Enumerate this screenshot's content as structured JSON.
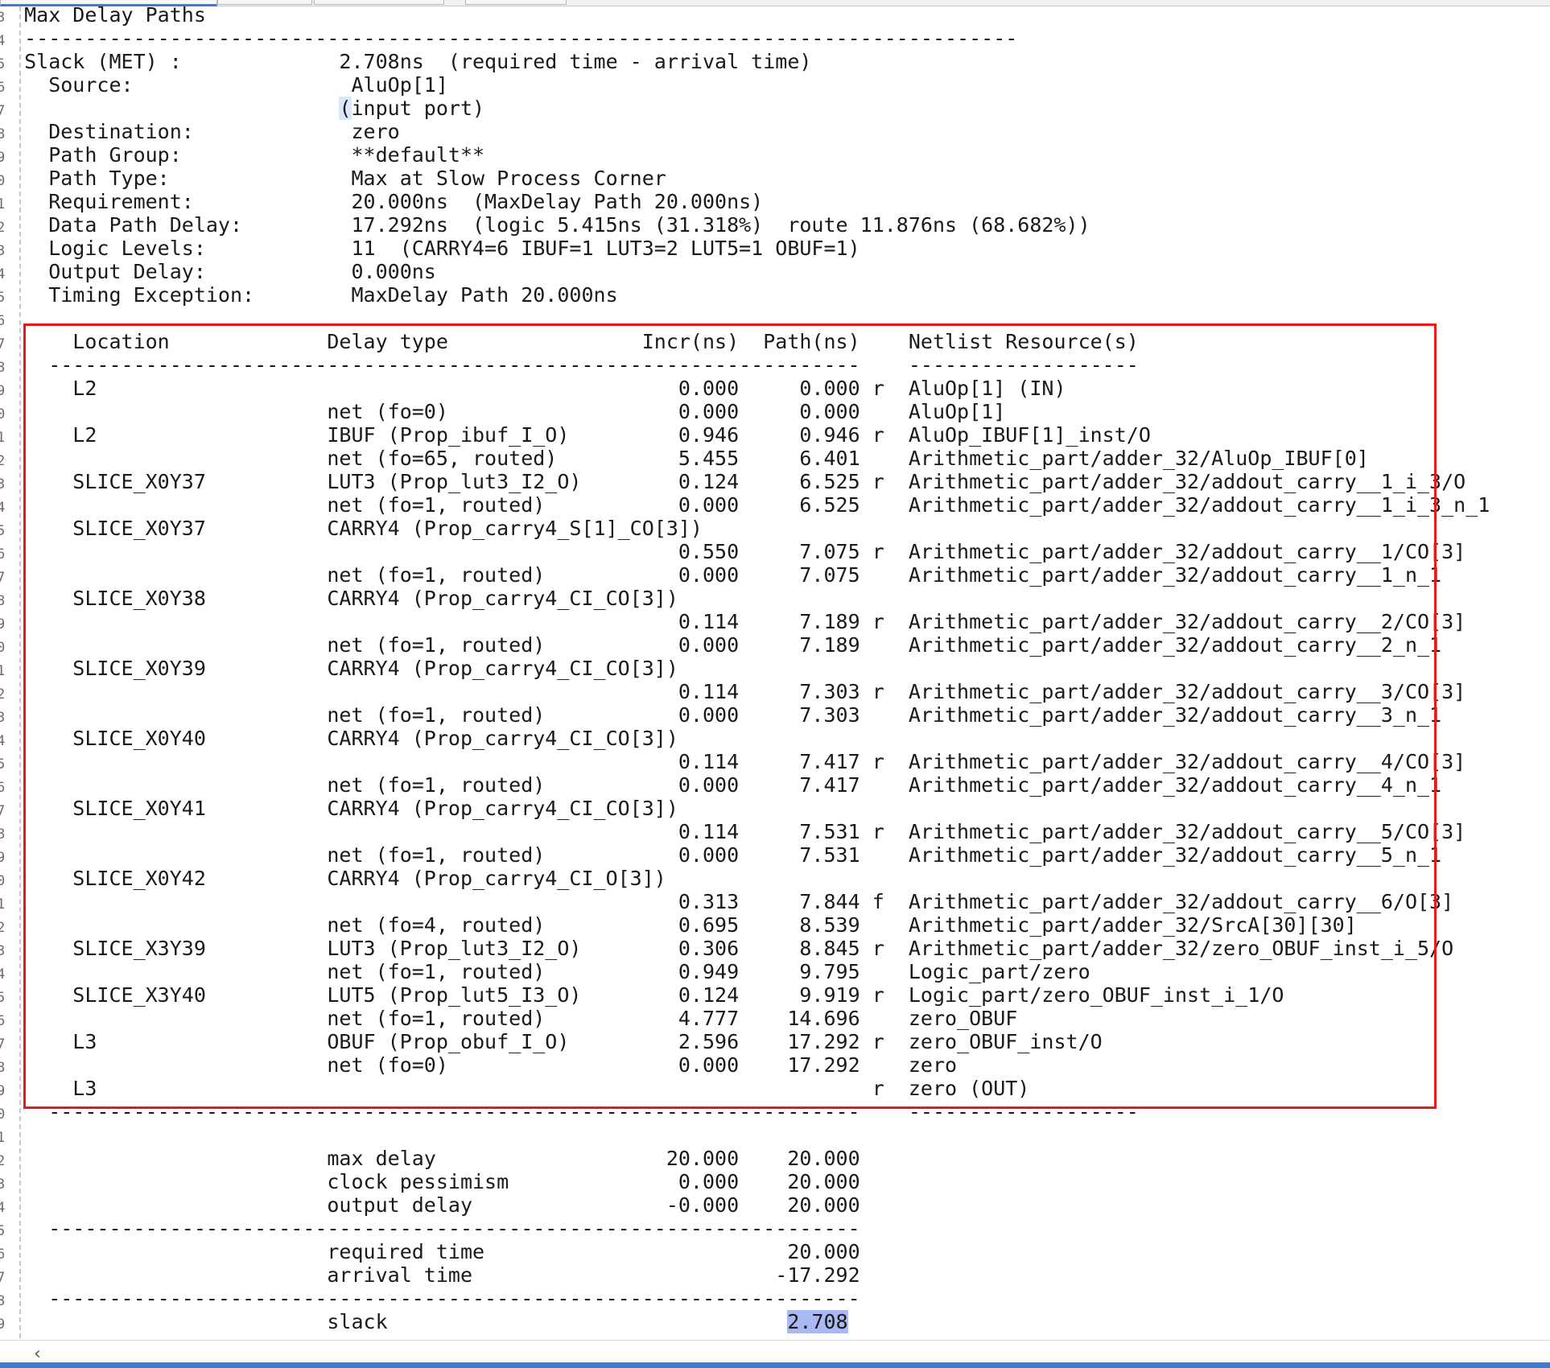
{
  "tabs": [
    "",
    "",
    "",
    ""
  ],
  "scroll_left_icon": "chevron-left-icon",
  "gutter_numbers": [
    "3",
    "4",
    "5",
    "6",
    "7",
    "8",
    "9",
    "0",
    "1",
    "2",
    "3",
    "4",
    "5",
    "6",
    "7",
    "8",
    "9",
    "0",
    "1",
    "2",
    "3",
    "4",
    "5",
    "6",
    "7",
    "8",
    "9",
    "0",
    "1",
    "2",
    "3",
    "4",
    "5",
    "6",
    "7",
    "8",
    "9",
    "0",
    "1",
    "2",
    "3",
    "4",
    "5",
    "6",
    "7",
    "8",
    "9",
    "0",
    "1",
    "2",
    "3",
    "4",
    "5",
    "6",
    "7",
    "8",
    "9"
  ],
  "lines": [
    {
      "text": "  Max Delay Paths"
    },
    {
      "text": "  ----------------------------------------------------------------------------------"
    },
    {
      "text": "  Slack (MET) :             2.708ns  (required time - arrival time)"
    },
    {
      "text": "    Source:                  AluOp[1]"
    },
    {
      "text": "                            ",
      "hl": "(",
      "text2": "input port)"
    },
    {
      "text": "    Destination:             zero"
    },
    {
      "text": "    Path Group:              **default**"
    },
    {
      "text": "    Path Type:               Max at Slow Process Corner"
    },
    {
      "text": "    Requirement:             20.000ns  (MaxDelay Path 20.000ns)"
    },
    {
      "text": "    Data Path Delay:         17.292ns  (logic 5.415ns (31.318%)  route 11.876ns (68.682%))"
    },
    {
      "text": "    Logic Levels:            11  (CARRY4=6 IBUF=1 LUT3=2 LUT5=1 OBUF=1)"
    },
    {
      "text": "    Output Delay:            0.000ns"
    },
    {
      "text": "    Timing Exception:        MaxDelay Path 20.000ns"
    },
    {
      "text": ""
    },
    {
      "text": "      Location             Delay type                Incr(ns)  Path(ns)    Netlist Resource(s)"
    },
    {
      "text": "    -------------------------------------------------------------------    -------------------"
    },
    {
      "text": "      L2                                                0.000     0.000 r  AluOp[1] (IN)"
    },
    {
      "text": "                           net (fo=0)                   0.000     0.000    AluOp[1]"
    },
    {
      "text": "      L2                   IBUF (Prop_ibuf_I_O)         0.946     0.946 r  AluOp_IBUF[1]_inst/O"
    },
    {
      "text": "                           net (fo=65, routed)          5.455     6.401    Arithmetic_part/adder_32/AluOp_IBUF[0]"
    },
    {
      "text": "      SLICE_X0Y37          LUT3 (Prop_lut3_I2_O)        0.124     6.525 r  Arithmetic_part/adder_32/addout_carry__1_i_3/O"
    },
    {
      "text": "                           net (fo=1, routed)           0.000     6.525    Arithmetic_part/adder_32/addout_carry__1_i_3_n_1"
    },
    {
      "text": "      SLICE_X0Y37          CARRY4 (Prop_carry4_S[1]_CO[3])"
    },
    {
      "text": "                                                        0.550     7.075 r  Arithmetic_part/adder_32/addout_carry__1/CO[3]"
    },
    {
      "text": "                           net (fo=1, routed)           0.000     7.075    Arithmetic_part/adder_32/addout_carry__1_n_1"
    },
    {
      "text": "      SLICE_X0Y38          CARRY4 (Prop_carry4_CI_CO[3])"
    },
    {
      "text": "                                                        0.114     7.189 r  Arithmetic_part/adder_32/addout_carry__2/CO[3]"
    },
    {
      "text": "                           net (fo=1, routed)           0.000     7.189    Arithmetic_part/adder_32/addout_carry__2_n_1"
    },
    {
      "text": "      SLICE_X0Y39          CARRY4 (Prop_carry4_CI_CO[3])"
    },
    {
      "text": "                                                        0.114     7.303 r  Arithmetic_part/adder_32/addout_carry__3/CO[3]"
    },
    {
      "text": "                           net (fo=1, routed)           0.000     7.303    Arithmetic_part/adder_32/addout_carry__3_n_1"
    },
    {
      "text": "      SLICE_X0Y40          CARRY4 (Prop_carry4_CI_CO[3])"
    },
    {
      "text": "                                                        0.114     7.417 r  Arithmetic_part/adder_32/addout_carry__4/CO[3]"
    },
    {
      "text": "                           net (fo=1, routed)           0.000     7.417    Arithmetic_part/adder_32/addout_carry__4_n_1"
    },
    {
      "text": "      SLICE_X0Y41          CARRY4 (Prop_carry4_CI_CO[3])"
    },
    {
      "text": "                                                        0.114     7.531 r  Arithmetic_part/adder_32/addout_carry__5/CO[3]"
    },
    {
      "text": "                           net (fo=1, routed)           0.000     7.531    Arithmetic_part/adder_32/addout_carry__5_n_1"
    },
    {
      "text": "      SLICE_X0Y42          CARRY4 (Prop_carry4_CI_O[3])"
    },
    {
      "text": "                                                        0.313     7.844 f  Arithmetic_part/adder_32/addout_carry__6/O[3]"
    },
    {
      "text": "                           net (fo=4, routed)           0.695     8.539    Arithmetic_part/adder_32/SrcA[30][30]"
    },
    {
      "text": "      SLICE_X3Y39          LUT3 (Prop_lut3_I2_O)        0.306     8.845 r  Arithmetic_part/adder_32/zero_OBUF_inst_i_5/O"
    },
    {
      "text": "                           net (fo=1, routed)           0.949     9.795    Logic_part/zero"
    },
    {
      "text": "      SLICE_X3Y40          LUT5 (Prop_lut5_I3_O)        0.124     9.919 r  Logic_part/zero_OBUF_inst_i_1/O"
    },
    {
      "text": "                           net (fo=1, routed)           4.777    14.696    zero_OBUF"
    },
    {
      "text": "      L3                   OBUF (Prop_obuf_I_O)         2.596    17.292 r  zero_OBUF_inst/O"
    },
    {
      "text": "                           net (fo=0)                   0.000    17.292    zero"
    },
    {
      "text": "      L3                                                                r  zero (OUT)"
    },
    {
      "text": "    -------------------------------------------------------------------    -------------------"
    },
    {
      "text": ""
    },
    {
      "text": "                           max delay                   20.000    20.000"
    },
    {
      "text": "                           clock pessimism              0.000    20.000"
    },
    {
      "text": "                           output delay                -0.000    20.000"
    },
    {
      "text": "    -------------------------------------------------------------------"
    },
    {
      "text": "                           required time                         20.000"
    },
    {
      "text": "                           arrival time                         -17.292"
    },
    {
      "text": "    -------------------------------------------------------------------"
    },
    {
      "text": "                           slack                                 ",
      "sel": "2.708"
    }
  ]
}
